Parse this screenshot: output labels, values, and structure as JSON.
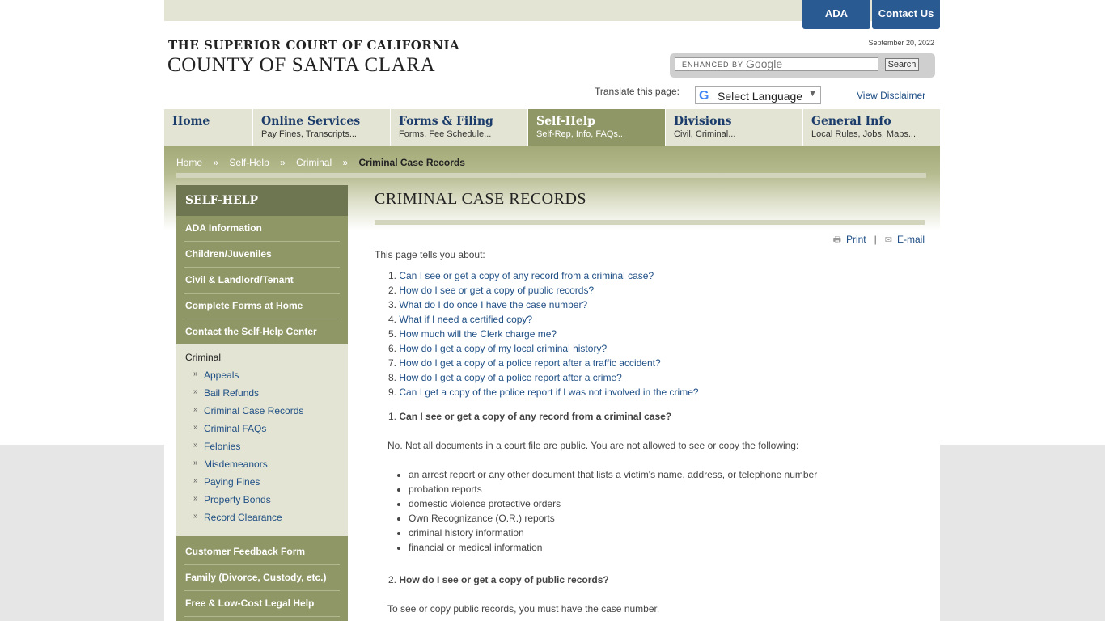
{
  "header": {
    "ada_label": "ADA",
    "contact_label": "Contact Us",
    "logo_line1": "THE SUPERIOR COURT OF CALIFORNIA",
    "logo_line2": "COUNTY OF SANTA CLARA",
    "date": "September 20, 2022",
    "search_enhanced": "ENHANCED BY",
    "search_google": "Google",
    "search_button": "Search",
    "translate_label": "Translate this page:",
    "language_select": "Select Language",
    "disclaimer": "View Disclaimer"
  },
  "nav": [
    {
      "title": "Home",
      "sub": ""
    },
    {
      "title": "Online Services",
      "sub": "Pay Fines, Transcripts..."
    },
    {
      "title": "Forms & Filing",
      "sub": "Forms, Fee Schedule..."
    },
    {
      "title": "Self-Help",
      "sub": "Self-Rep, Info, FAQs..."
    },
    {
      "title": "Divisions",
      "sub": "Civil, Criminal..."
    },
    {
      "title": "General Info",
      "sub": "Local Rules, Jobs, Maps..."
    }
  ],
  "breadcrumb": {
    "home": "Home",
    "sep": "»",
    "selfhelp": "Self-Help",
    "criminal": "Criminal",
    "current": "Criminal Case Records"
  },
  "sidebar": {
    "heading": "SELF-HELP",
    "items_top": [
      "ADA Information",
      "Children/Juveniles",
      "Civil & Landlord/Tenant",
      "Complete Forms at Home",
      "Contact the Self-Help Center"
    ],
    "section_title": "Criminal",
    "sub_items": [
      "Appeals",
      "Bail Refunds",
      "Criminal Case Records",
      "Criminal FAQs",
      "Felonies",
      "Misdemeanors",
      "Paying Fines",
      "Property Bonds",
      "Record Clearance"
    ],
    "items_bottom": [
      "Customer Feedback Form",
      "Family (Divorce, Custody, etc.)",
      "Free & Low-Cost Legal Help"
    ],
    "bullet": "»"
  },
  "content": {
    "title": "CRIMINAL CASE RECORDS",
    "print": "Print",
    "tool_sep": "|",
    "email": "E-mail",
    "intro": "This page tells you about:",
    "toc": [
      "Can I see or get a copy of any record from a criminal case?",
      "How do I see or get a copy of public records?",
      "What do I do once I have the case number?",
      "What if I need a certified copy?",
      "How much will the Clerk charge me?",
      "How do I get a copy of my local criminal history?",
      "How do I get a copy of a police report after a traffic accident?",
      "How do I get a copy of a police report after a crime?",
      "Can I get a copy of the police report if I was not involved in the crime?"
    ],
    "section1_num": "1.",
    "section1_title": "Can I see or get a copy of any record from a criminal case?",
    "section1_text": "No. Not all documents in a court file are public. You are not allowed to see or copy the following:",
    "section1_bullets": [
      "an arrest report or any other document that lists a victim's name, address, or telephone number",
      "probation reports",
      "domestic violence protective orders",
      "Own Recognizance (O.R.) reports",
      "criminal history information",
      "financial or medical information"
    ],
    "section2_num": "2.",
    "section2_title": "How do I see or get a copy of public records?",
    "section2_text": "To see or copy public records, you must have the case number."
  }
}
